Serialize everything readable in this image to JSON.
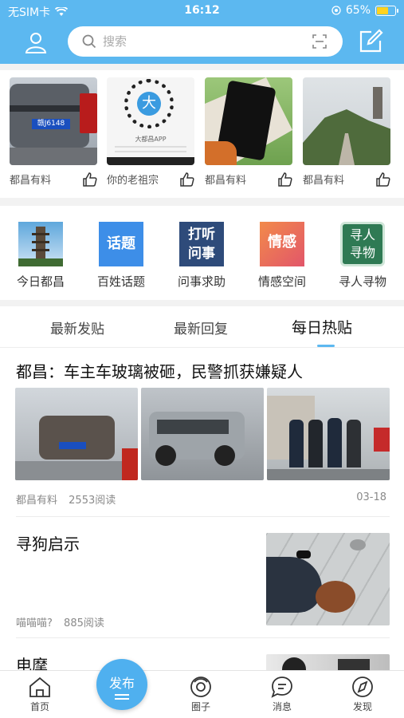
{
  "status": {
    "carrier": "无SIM卡",
    "time": "16:12",
    "battery": "65%",
    "battery_level": 0.65
  },
  "search": {
    "placeholder": "搜索"
  },
  "banner": [
    {
      "caption": "都昌有料",
      "plate": "赣J6148"
    },
    {
      "caption": "你的老祖宗",
      "qr_text": "大都昌APP"
    },
    {
      "caption": "都昌有料"
    },
    {
      "caption": "都昌有料"
    }
  ],
  "categories": [
    {
      "label": "今日都昌"
    },
    {
      "label": "百姓话题",
      "icon_text": "话题"
    },
    {
      "label": "问事求助",
      "icon_text": "打听问事"
    },
    {
      "label": "情感空间",
      "icon_text": "情感"
    },
    {
      "label": "寻人寻物",
      "icon_text": "寻人寻物"
    }
  ],
  "tabs": [
    {
      "label": "最新发贴"
    },
    {
      "label": "最新回复"
    },
    {
      "label": "每日热贴",
      "active": true
    }
  ],
  "posts": [
    {
      "title": "都昌：车主车玻璃被砸，民警抓获嫌疑人",
      "author": "都昌有料",
      "views": "2553阅读",
      "date": "03-18"
    },
    {
      "title": "寻狗启示",
      "author": "喵喵喵?",
      "views": "885阅读"
    },
    {
      "title": "电摩"
    }
  ],
  "nav": [
    {
      "label": "首页"
    },
    {
      "label": "圈子"
    },
    {
      "label": "消息"
    },
    {
      "label": "发现"
    }
  ],
  "publish": {
    "label": "发布"
  },
  "colors": {
    "accent": "#5cb8f0",
    "battery": "#ffd21f"
  }
}
